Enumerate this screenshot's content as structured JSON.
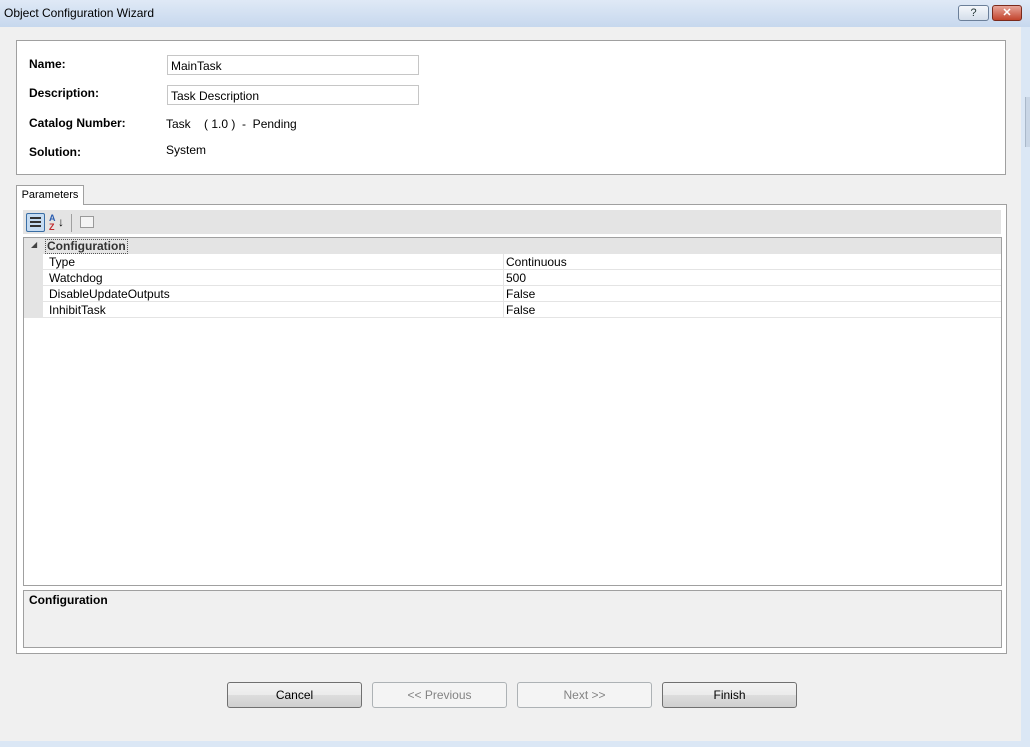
{
  "window": {
    "title": "Object Configuration Wizard",
    "help_glyph": "?",
    "close_glyph": "✕"
  },
  "header": {
    "name_label": "Name:",
    "name_value": "MainTask",
    "description_label": "Description:",
    "description_value": "Task Description",
    "catalog_label": "Catalog Number:",
    "catalog_value": "Task    ( 1.0 )  -  Pending",
    "solution_label": "Solution:",
    "solution_value": "System"
  },
  "tabs": [
    {
      "label": "Parameters",
      "selected": true
    }
  ],
  "toolbar": {
    "categorized_icon": "categorized-icon",
    "alphabetical_icon": "sort-az-icon",
    "property_pages_icon": "property-pages-icon"
  },
  "property_grid": {
    "category": {
      "label": "Configuration",
      "toggle": "◢",
      "expanded": true
    },
    "rows": [
      {
        "name": "Type",
        "value": "Continuous"
      },
      {
        "name": "Watchdog",
        "value": "500"
      },
      {
        "name": "DisableUpdateOutputs",
        "value": "False"
      },
      {
        "name": "InhibitTask",
        "value": "False"
      }
    ]
  },
  "help_panel": {
    "title": "Configuration"
  },
  "buttons": {
    "cancel": "Cancel",
    "previous": "<< Previous",
    "next": "Next >>",
    "finish": "Finish"
  },
  "colors": {
    "frame": "#dbe7f5",
    "client": "#f0f0f0",
    "close_button": "#c2442c"
  }
}
